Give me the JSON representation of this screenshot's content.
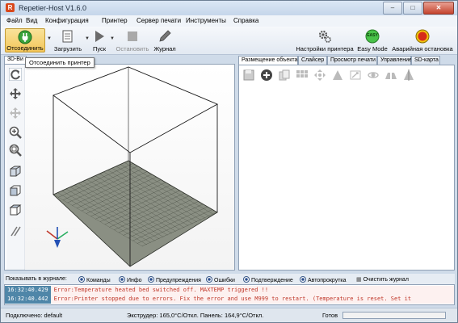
{
  "window": {
    "title": "Repetier-Host V1.6.0",
    "app_icon_letter": "R"
  },
  "menu": [
    "Файл",
    "Вид",
    "Конфигурация",
    "Принтер",
    "Сервер печати",
    "Инструменты",
    "Справка"
  ],
  "toolbar": {
    "disconnect": "Отсоединить",
    "load": "Загрузить",
    "run": "Пуск",
    "stop": "Остановить",
    "log": "Журнал",
    "printer_settings": "Настройки принтера",
    "easy_mode": "Easy Mode",
    "easy_badge": "EASY",
    "emergency": "Аварийная остановка"
  },
  "tooltip": "Отсоединить принтер",
  "view_tab": "3D-Ви",
  "right_tabs": [
    "Размещение объекта",
    "Слайсер",
    "Просмотр печати",
    "Управление",
    "SD-карта"
  ],
  "log_bar": {
    "show_label": "Показывать в журнале:",
    "commands": "Команды",
    "info": "Инфо",
    "warnings": "Предупреждения",
    "errors": "Ошибки",
    "ack": "Подтверждение",
    "autoscroll": "Автопрокрутка",
    "clear": "Очистить журнал"
  },
  "log": [
    {
      "time": "16:32:40.429",
      "msg": "Error:Temperature heated bed switched off. MAXTEMP triggered !!"
    },
    {
      "time": "16:32:40.442",
      "msg": "Error:Printer stopped due to errors. Fix the error and use M999 to restart. (Temperature is reset. Set it"
    }
  ],
  "status": {
    "connection": "Подключено: default",
    "temps": "Экструдер: 165,0°C/Откл. Панель: 164,9°C/Откл.",
    "ready": "Готов",
    "progress": 0
  },
  "colors": {
    "accent": "#f3c65a",
    "log_time_bg": "#4f86a8",
    "error_text": "#c0392b",
    "bed": "#8a8f83"
  }
}
